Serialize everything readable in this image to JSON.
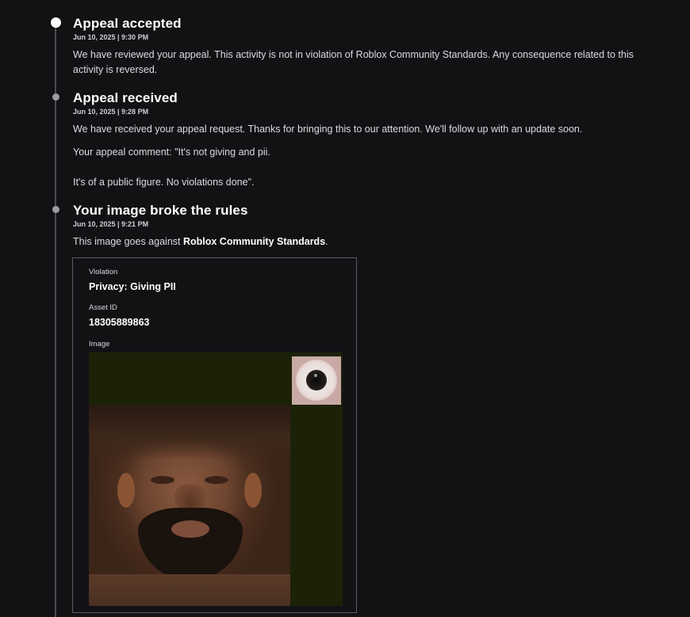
{
  "events": [
    {
      "title": "Appeal accepted",
      "timestamp": "Jun 10, 2025 | 9:30 PM",
      "body": "We have reviewed your appeal. This activity is not in violation of Roblox Community Standards. Any consequence related to this activity is reversed."
    },
    {
      "title": "Appeal received",
      "timestamp": "Jun 10, 2025 | 9:28 PM",
      "body": "We have received your appeal request. Thanks for bringing this to our attention. We'll follow up with an update soon.",
      "comment_line1": "Your appeal comment: \"It's not giving and pii.",
      "comment_line2": "It's of a public figure. No violations done\"."
    },
    {
      "title": "Your image broke the rules",
      "timestamp": "Jun 10, 2025 | 9:21 PM",
      "body_prefix": "This image goes against ",
      "body_link": "Roblox Community Standards",
      "body_suffix": "."
    }
  ],
  "violation_card": {
    "violation_label": "Violation",
    "violation_value": "Privacy: Giving PII",
    "asset_id_label": "Asset ID",
    "asset_id_value": "18305889863",
    "image_label": "Image"
  },
  "colors": {
    "background": "#121215",
    "texture_background": "#1b2207",
    "timeline_rail": "#4a4a50"
  }
}
